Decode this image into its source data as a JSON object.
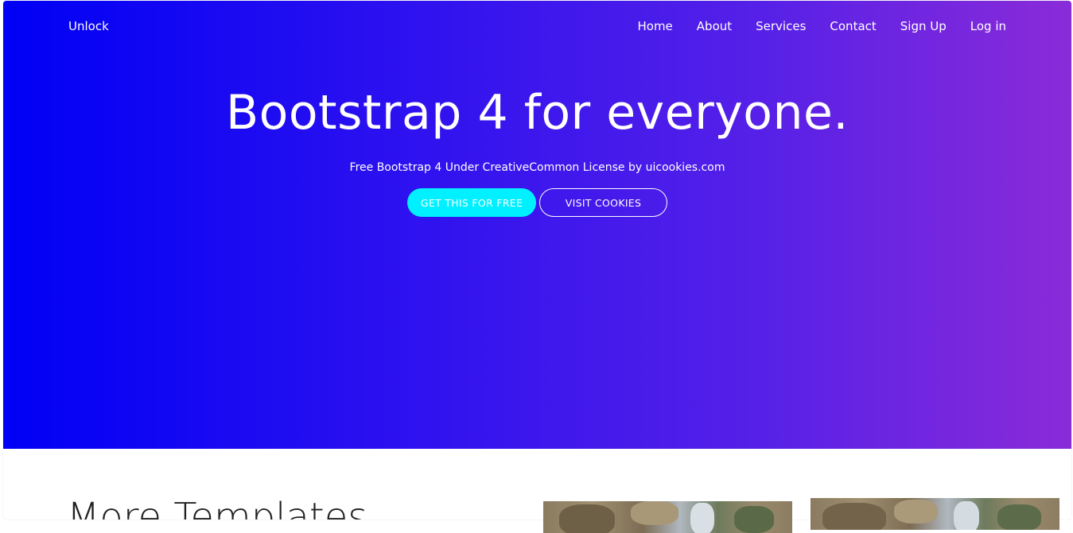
{
  "navbar": {
    "brand": "Unlock",
    "links": [
      "Home",
      "About",
      "Services",
      "Contact",
      "Sign Up",
      "Log in"
    ]
  },
  "hero": {
    "title": "Bootstrap 4 for everyone.",
    "subtitle": "Free Bootstrap 4 Under CreativeCommon License by uicookies.com",
    "primary_button": "GET THIS FOR FREE",
    "secondary_button": "VISIT COOKIES",
    "gradient_start": "#0000f5",
    "gradient_end": "#8a2bd8",
    "primary_button_color": "#00f0ff"
  },
  "section": {
    "title": "More Templates"
  }
}
